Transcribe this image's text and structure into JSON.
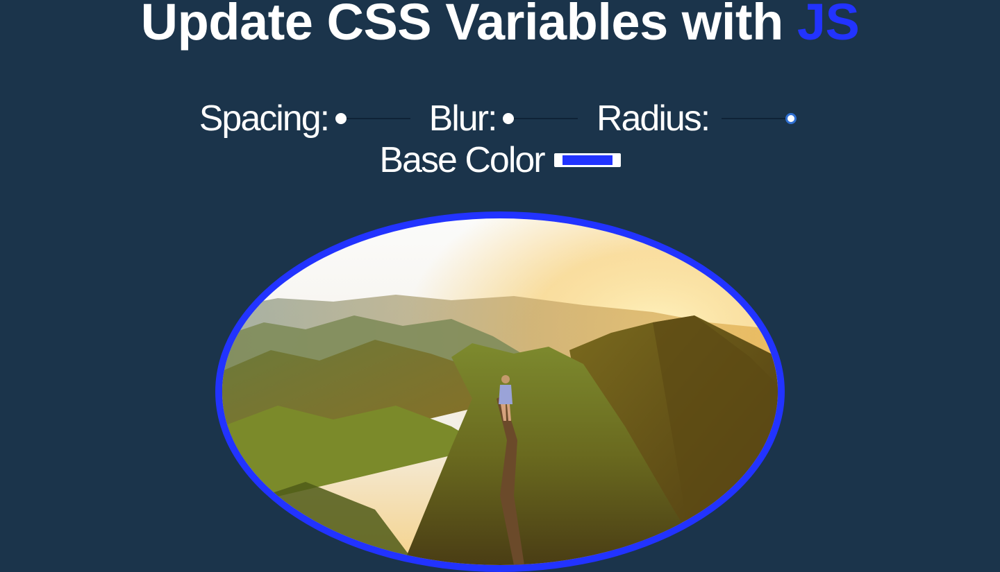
{
  "title": {
    "text": "Update CSS Variables with ",
    "highlight": "JS"
  },
  "controls": {
    "spacing": {
      "label": "Spacing:",
      "value": 0
    },
    "blur": {
      "label": "Blur:",
      "value": 0
    },
    "radius": {
      "label": "Radius:",
      "value": 1
    },
    "base_color": {
      "label": "Base Color",
      "value": "#2233ff"
    }
  },
  "colors": {
    "background": "#1b344b",
    "accent": "#2233ff"
  },
  "image": {
    "subject": "mountain-ridge-hiker-photo"
  }
}
